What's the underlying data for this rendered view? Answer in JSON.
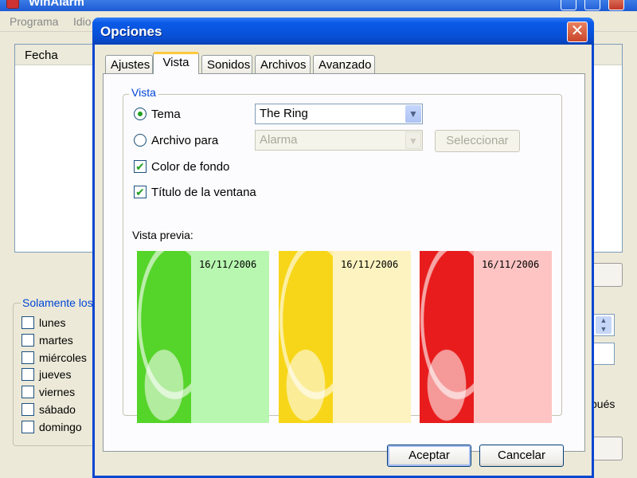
{
  "main_window": {
    "title": "WinAlarm",
    "menu": [
      "Programa",
      "Idio"
    ],
    "list_header": "Fecha",
    "days_group_label": "Solamente los",
    "days": [
      "lunes",
      "martes",
      "miércoles",
      "jueves",
      "viernes",
      "sábado",
      "domingo"
    ],
    "partial_text": "pués"
  },
  "dialog": {
    "title": "Opciones",
    "tabs": [
      {
        "label": "Ajustes"
      },
      {
        "label": "Vista"
      },
      {
        "label": "Sonidos"
      },
      {
        "label": "Archivos"
      },
      {
        "label": "Avanzado"
      }
    ],
    "active_tab": "Vista",
    "vista": {
      "group_label": "Vista",
      "tema_label": "Tema",
      "tema_value": "The Ring",
      "archivo_label": "Archivo para",
      "archivo_value": "Alarma",
      "seleccionar_label": "Seleccionar",
      "color_fondo_label": "Color de fondo",
      "titulo_ventana_label": "Título de la ventana",
      "preview_label": "Vista previa:",
      "previews": [
        {
          "date": "16/11/2006",
          "theme_color": "#55d42a",
          "body_color": "#b8f7b0"
        },
        {
          "date": "16/11/2006",
          "theme_color": "#f7d619",
          "body_color": "#fdf3c0"
        },
        {
          "date": "16/11/2006",
          "theme_color": "#e81c1c",
          "body_color": "#fec4c4"
        }
      ]
    },
    "buttons": {
      "accept": "Aceptar",
      "cancel": "Cancelar"
    }
  },
  "icons": {
    "close": "✕",
    "dropdown": "▼",
    "check": "✔"
  }
}
